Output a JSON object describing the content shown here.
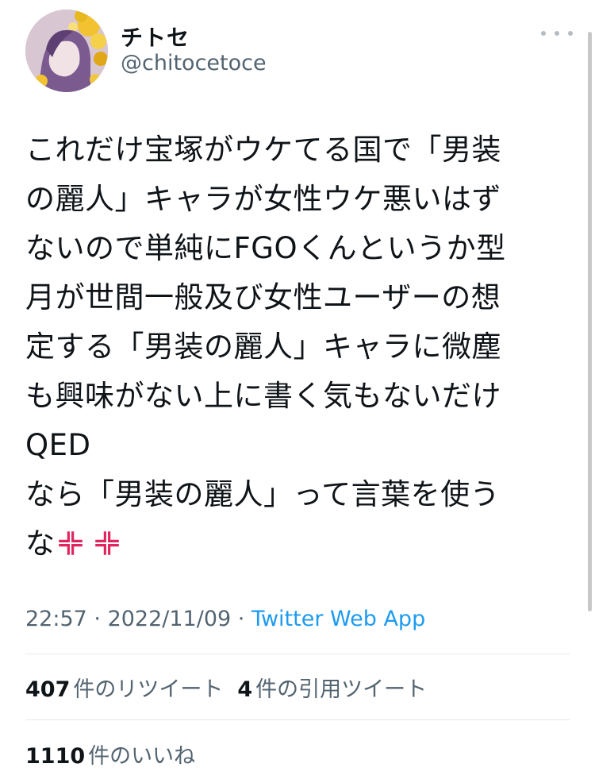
{
  "author": {
    "display_name": "チトセ",
    "handle": "@chitocetoce"
  },
  "tweet": {
    "lines": [
      "これだけ宝塚がウケてる国で「男装",
      "の麗人」キャラが女性ウケ悪いはず",
      "ないので単純にFGOくんというか型",
      "月が世間一般及び女性ユーザーの想",
      "定する「男装の麗人」キャラに微塵",
      "も興味がない上に書く気もないだけ",
      "QED",
      "なら「男装の麗人」って言葉を使う",
      "な"
    ],
    "emojis": [
      "anger-symbol",
      "anger-symbol"
    ],
    "time": "22:57",
    "date": "2022/11/09",
    "separator": " · ",
    "source": "Twitter Web App"
  },
  "stats": {
    "retweets_count": "407",
    "retweets_label": "件のリツイート",
    "quotes_count": "4",
    "quotes_label": "件の引用ツイート",
    "likes_count": "1110",
    "likes_label": "件のいいね"
  },
  "colors": {
    "text": "#0f1419",
    "secondary": "#536471",
    "link": "#1d9bf0",
    "anger": "#e0245e"
  }
}
